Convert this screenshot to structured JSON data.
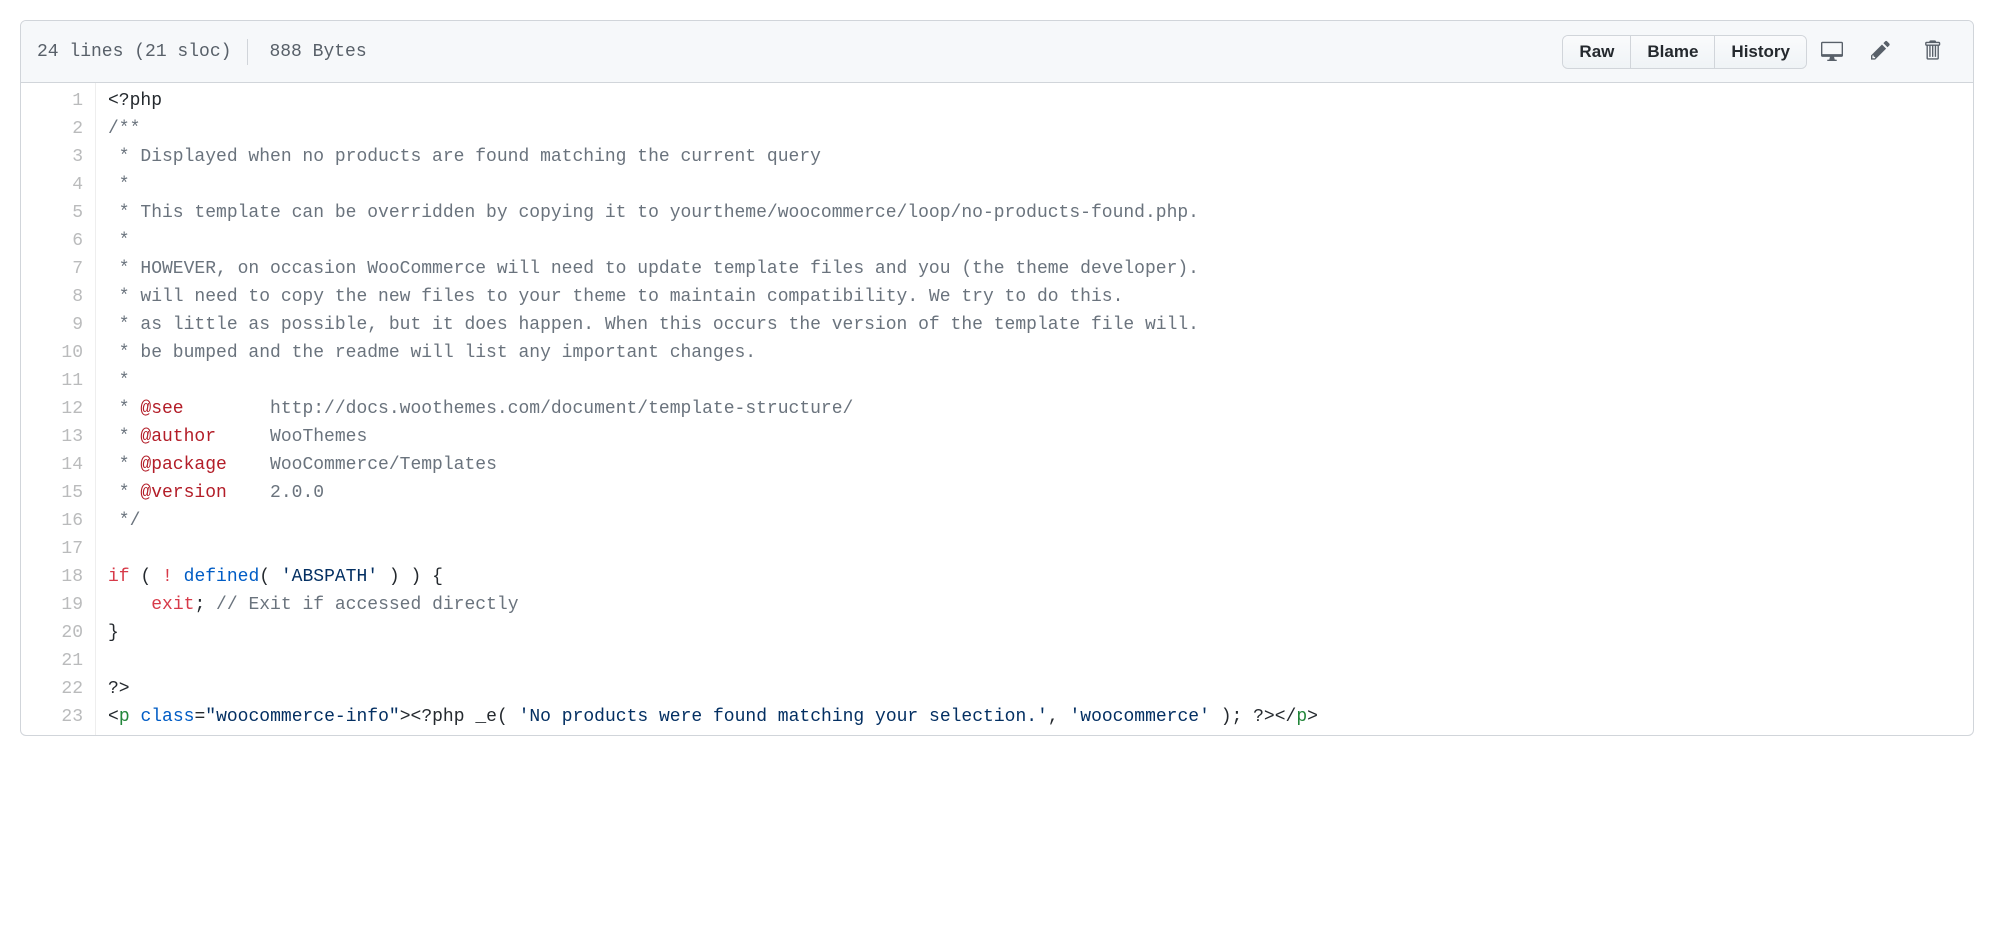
{
  "header": {
    "lines_text": "24 lines (21 sloc)",
    "bytes_text": "888 Bytes",
    "raw_label": "Raw",
    "blame_label": "Blame",
    "history_label": "History"
  },
  "code": {
    "line_numbers": [
      "1",
      "2",
      "3",
      "4",
      "5",
      "6",
      "7",
      "8",
      "9",
      "10",
      "11",
      "12",
      "13",
      "14",
      "15",
      "16",
      "17",
      "18",
      "19",
      "20",
      "21",
      "22",
      "23"
    ],
    "lines": [
      {
        "tokens": [
          {
            "t": "<?php",
            "c": "pl-php"
          }
        ]
      },
      {
        "tokens": [
          {
            "t": "/**",
            "c": "pl-c"
          }
        ]
      },
      {
        "tokens": [
          {
            "t": " * Displayed when no products are found matching the current query",
            "c": "pl-c"
          }
        ]
      },
      {
        "tokens": [
          {
            "t": " *",
            "c": "pl-c"
          }
        ]
      },
      {
        "tokens": [
          {
            "t": " * This template can be overridden by copying it to yourtheme/woocommerce/loop/no-products-found.php.",
            "c": "pl-c"
          }
        ]
      },
      {
        "tokens": [
          {
            "t": " *",
            "c": "pl-c"
          }
        ]
      },
      {
        "tokens": [
          {
            "t": " * HOWEVER, on occasion WooCommerce will need to update template files and you (the theme developer).",
            "c": "pl-c"
          }
        ]
      },
      {
        "tokens": [
          {
            "t": " * will need to copy the new files to your theme to maintain compatibility. We try to do this.",
            "c": "pl-c"
          }
        ]
      },
      {
        "tokens": [
          {
            "t": " * as little as possible, but it does happen. When this occurs the version of the template file will.",
            "c": "pl-c"
          }
        ]
      },
      {
        "tokens": [
          {
            "t": " * be bumped and the readme will list any important changes.",
            "c": "pl-c"
          }
        ]
      },
      {
        "tokens": [
          {
            "t": " *",
            "c": "pl-c"
          }
        ]
      },
      {
        "tokens": [
          {
            "t": " * ",
            "c": "pl-c"
          },
          {
            "t": "@see",
            "c": "pl-doctag"
          },
          {
            "t": "        http://docs.woothemes.com/document/template-structure/",
            "c": "pl-c"
          }
        ]
      },
      {
        "tokens": [
          {
            "t": " * ",
            "c": "pl-c"
          },
          {
            "t": "@author",
            "c": "pl-doctag"
          },
          {
            "t": "     WooThemes",
            "c": "pl-c"
          }
        ]
      },
      {
        "tokens": [
          {
            "t": " * ",
            "c": "pl-c"
          },
          {
            "t": "@package",
            "c": "pl-doctag"
          },
          {
            "t": "    WooCommerce/Templates",
            "c": "pl-c"
          }
        ]
      },
      {
        "tokens": [
          {
            "t": " * ",
            "c": "pl-c"
          },
          {
            "t": "@version",
            "c": "pl-doctag"
          },
          {
            "t": "    2.0.0",
            "c": "pl-c"
          }
        ]
      },
      {
        "tokens": [
          {
            "t": " */",
            "c": "pl-c"
          }
        ]
      },
      {
        "tokens": [
          {
            "t": "",
            "c": "pl-php"
          }
        ]
      },
      {
        "tokens": [
          {
            "t": "if",
            "c": "pl-k"
          },
          {
            "t": " ( ",
            "c": "pl-php"
          },
          {
            "t": "!",
            "c": "pl-k"
          },
          {
            "t": " ",
            "c": "pl-php"
          },
          {
            "t": "defined",
            "c": "pl-en"
          },
          {
            "t": "( ",
            "c": "pl-php"
          },
          {
            "t": "'ABSPATH'",
            "c": "pl-s"
          },
          {
            "t": " ) ) {",
            "c": "pl-php"
          }
        ]
      },
      {
        "tokens": [
          {
            "t": "    ",
            "c": "pl-php"
          },
          {
            "t": "exit",
            "c": "pl-k"
          },
          {
            "t": "; ",
            "c": "pl-php"
          },
          {
            "t": "// Exit if accessed directly",
            "c": "pl-c"
          }
        ]
      },
      {
        "tokens": [
          {
            "t": "}",
            "c": "pl-php"
          }
        ]
      },
      {
        "tokens": [
          {
            "t": "",
            "c": "pl-php"
          }
        ]
      },
      {
        "tokens": [
          {
            "t": "?>",
            "c": "pl-php"
          }
        ]
      },
      {
        "tokens": [
          {
            "t": "<",
            "c": "pl-php"
          },
          {
            "t": "p",
            "c": "pl-ent"
          },
          {
            "t": " ",
            "c": "pl-php"
          },
          {
            "t": "class",
            "c": "pl-attr"
          },
          {
            "t": "=",
            "c": "pl-php"
          },
          {
            "t": "\"",
            "c": "pl-s"
          },
          {
            "t": "woocommerce-info",
            "c": "pl-s"
          },
          {
            "t": "\"",
            "c": "pl-s"
          },
          {
            "t": ">",
            "c": "pl-php"
          },
          {
            "t": "<?php",
            "c": "pl-php"
          },
          {
            "t": " _e( ",
            "c": "pl-php"
          },
          {
            "t": "'No products were found matching your selection.'",
            "c": "pl-s"
          },
          {
            "t": ", ",
            "c": "pl-php"
          },
          {
            "t": "'woocommerce'",
            "c": "pl-s"
          },
          {
            "t": " ); ",
            "c": "pl-php"
          },
          {
            "t": "?>",
            "c": "pl-php"
          },
          {
            "t": "</",
            "c": "pl-php"
          },
          {
            "t": "p",
            "c": "pl-ent"
          },
          {
            "t": ">",
            "c": "pl-php"
          }
        ]
      }
    ]
  }
}
